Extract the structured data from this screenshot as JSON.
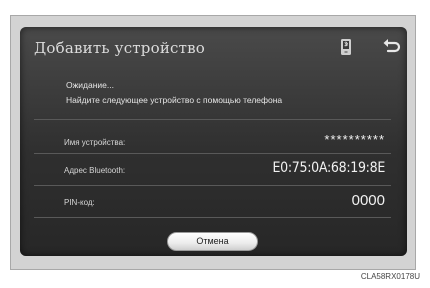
{
  "screen": {
    "title": "Добавить устройство",
    "status_line": "Ожидание...",
    "instruction": "Найдите следующее устройство с помощью телефона",
    "back_icon": "back-arrow-icon",
    "bluetooth_icon": "bluetooth-phone-icon"
  },
  "rows": [
    {
      "label": "Имя устройства:",
      "value": "**********"
    },
    {
      "label": "Адрес Bluetooth:",
      "value": "E0:75:0A:68:19:8E"
    },
    {
      "label": "PIN-код:",
      "value": "0000"
    }
  ],
  "buttons": {
    "cancel": "Отмена"
  },
  "figure_code": "CLA58RX0178U"
}
